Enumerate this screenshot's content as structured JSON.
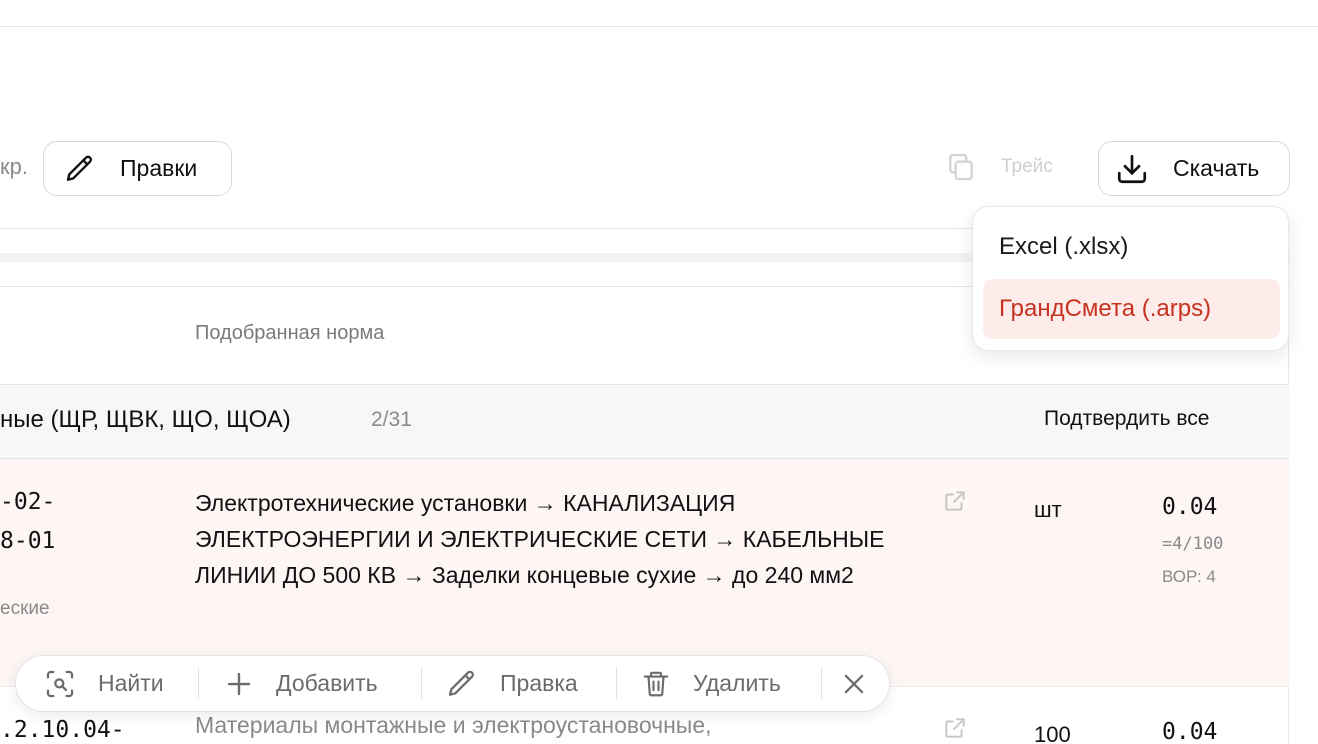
{
  "toolbar": {
    "cut_label": "кр.",
    "edits_label": "Правки",
    "trace_label": "Трейс",
    "download_label": "Скачать"
  },
  "download_menu": {
    "items": [
      {
        "label": "Excel (.xlsx)"
      },
      {
        "label": "ГрандСмета (.arps)",
        "highlighted": true
      }
    ]
  },
  "table": {
    "column_header": "Подобранная норма",
    "group": {
      "title": "ные (ЩР, ЩВК, ЩО, ЩОА)",
      "count": "2/31",
      "confirm_all": "Подтвердить все"
    },
    "rows": [
      {
        "code_lines": [
          "-02-",
          "8-01"
        ],
        "cut_label": "еские",
        "description": "Электротехнические установки → КАНАЛИЗАЦИЯ ЭЛЕКТРОЭНЕРГИИ И ЭЛЕКТРИЧЕСКИЕ СЕТИ → КАБЕЛЬНЫЕ ЛИНИИ ДО 500 КВ → Заделки концевые сухие → до 240 мм2",
        "unit": "шт",
        "quantity": "0.04",
        "formula": "=4/100",
        "vor": "ВОР: 4"
      },
      {
        "code_lines": [
          ".2.10.04-"
        ],
        "description": "Материалы монтажные и электроустановочные,",
        "unit": "100",
        "quantity": "0.04"
      }
    ]
  },
  "action_bar": {
    "find_label": "Найти",
    "add_label": "Добавить",
    "edit_label": "Правка",
    "delete_label": "Удалить"
  },
  "colors": {
    "accent_red": "#c6321f",
    "highlight_bg": "#fdecea",
    "row_bg": "#fdf6f5"
  }
}
